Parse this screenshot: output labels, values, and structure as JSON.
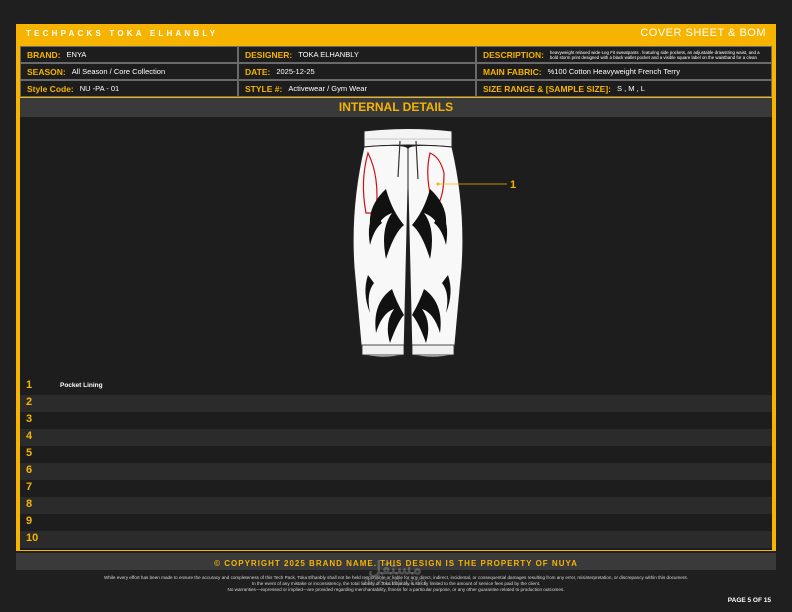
{
  "header": {
    "left_title": "TECHPACKS TOKA ELHANBLY",
    "right_title": "COVER SHEET & BOM"
  },
  "info": {
    "brand_label": "BRAND:",
    "brand": "ENYA",
    "designer_label": "DESIGNER:",
    "designer": "TOKA ELHANBLY",
    "description_label": "DESCRIPTION:",
    "description": "heavyweight relaxed wide-Leg Fit sweatpants . featuring side pockets, an adjustable drawstring waist, and a bold storm print designed with a black wallet pocket and a visible square label on the waistband for a clean",
    "season_label": "SEASON:",
    "season": "All Season / Core Collection",
    "date_label": "DATE:",
    "date": "2025-12-25",
    "fabric_label": "MAIN FABRIC:",
    "fabric": "%100 Cotton Heavyweight French Terry",
    "style_code_label": "Style Code:",
    "style_code": "NU -PA - 01",
    "style_no_label": "STYLE #:",
    "style_no": "Activewear / Gym Wear",
    "size_label": "SIZE RANGE & [SAMPLE SIZE]:",
    "size": "S , M , L"
  },
  "section_title": "INTERNAL DETAILS",
  "callout_number": "1",
  "rows": [
    {
      "num": "1",
      "text": "Pocket Lining"
    },
    {
      "num": "2",
      "text": ""
    },
    {
      "num": "3",
      "text": ""
    },
    {
      "num": "4",
      "text": ""
    },
    {
      "num": "5",
      "text": ""
    },
    {
      "num": "6",
      "text": ""
    },
    {
      "num": "7",
      "text": ""
    },
    {
      "num": "8",
      "text": ""
    },
    {
      "num": "9",
      "text": ""
    },
    {
      "num": "10",
      "text": ""
    }
  ],
  "footer": {
    "copyright": "© COPYRIGHT 2025 BRAND NAME. THIS DESIGN IS THE PROPERTY OF NUYA",
    "disclaimer_1": "While every effort has been made to ensure the accuracy and completeness of this Tech Pack, Toka Elhanbly shall not be held responsible or liable for any direct, indirect, incidental, or consequential damages resulting from any error, misinterpretation, or discrepancy within this document.",
    "disclaimer_2": "In the event of any mistake or inconsistency, the total liability of Toka Elhanbly is strictly limited to the amount of service fees paid by the client.",
    "disclaimer_3": "No warranties—expressed or implied—are provided regarding merchantability, fitness for a particular purpose, or any other guarantee related to production outcomes.",
    "page": "PAGE 5 OF 15"
  },
  "watermark": {
    "line1": "مستقل",
    "line2": "mostaql.com"
  },
  "colors": {
    "accent": "#f6b400",
    "panel": "#1d1d1d",
    "section": "#3a3a3a"
  }
}
